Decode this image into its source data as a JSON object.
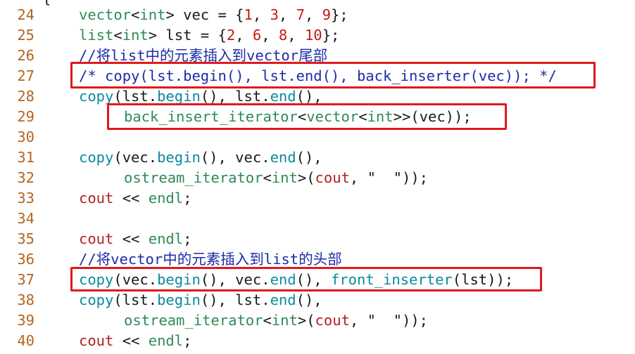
{
  "top_stub": "{",
  "lines": [
    {
      "num": "24",
      "tokens": [
        [
          "vector",
          "kw"
        ],
        [
          "<",
          ""
        ],
        [
          "int",
          "kw"
        ],
        [
          "> vec = {",
          ""
        ],
        [
          "1",
          "num"
        ],
        [
          ", ",
          ""
        ],
        [
          "3",
          "num"
        ],
        [
          ", ",
          ""
        ],
        [
          "7",
          "num"
        ],
        [
          ", ",
          ""
        ],
        [
          "9",
          "num"
        ],
        [
          "};",
          ""
        ]
      ]
    },
    {
      "num": "25",
      "tokens": [
        [
          "list",
          "kw"
        ],
        [
          "<",
          ""
        ],
        [
          "int",
          "kw"
        ],
        [
          "> lst = {",
          ""
        ],
        [
          "2",
          "num"
        ],
        [
          ", ",
          ""
        ],
        [
          "6",
          "num"
        ],
        [
          ", ",
          ""
        ],
        [
          "8",
          "num"
        ],
        [
          ", ",
          ""
        ],
        [
          "10",
          "num"
        ],
        [
          "};",
          ""
        ]
      ]
    },
    {
      "num": "26",
      "tokens": [
        [
          "//将list中的元素插入到vector尾部",
          "cm"
        ]
      ]
    },
    {
      "num": "27",
      "tokens": [
        [
          "/* copy(lst.begin(), lst.end(), back_inserter(vec)); */",
          "cm"
        ]
      ]
    },
    {
      "num": "28",
      "tokens": [
        [
          "copy",
          "fn"
        ],
        [
          "(lst.",
          ""
        ],
        [
          "begin",
          "fn"
        ],
        [
          "(), lst.",
          ""
        ],
        [
          "end",
          "fn"
        ],
        [
          "(),",
          ""
        ]
      ]
    },
    {
      "num": "29",
      "indent": 2,
      "tokens": [
        [
          "back_insert_iterator",
          "kw"
        ],
        [
          "<",
          ""
        ],
        [
          "vector",
          "kw"
        ],
        [
          "<",
          ""
        ],
        [
          "int",
          "kw"
        ],
        [
          ">>(vec));",
          ""
        ]
      ]
    },
    {
      "num": "30",
      "tokens": []
    },
    {
      "num": "31",
      "tokens": [
        [
          "copy",
          "fn"
        ],
        [
          "(vec.",
          ""
        ],
        [
          "begin",
          "fn"
        ],
        [
          "(), vec.",
          ""
        ],
        [
          "end",
          "fn"
        ],
        [
          "(),",
          ""
        ]
      ]
    },
    {
      "num": "32",
      "indent": 2,
      "tokens": [
        [
          "ostream_iterator",
          "kw"
        ],
        [
          "<",
          ""
        ],
        [
          "int",
          "kw"
        ],
        [
          ">(",
          ""
        ],
        [
          "cout",
          "str"
        ],
        [
          ", \"  \"));",
          ""
        ]
      ]
    },
    {
      "num": "33",
      "tokens": [
        [
          "cout",
          "str"
        ],
        [
          " << ",
          ""
        ],
        [
          "endl",
          "kw"
        ],
        [
          ";",
          ""
        ]
      ]
    },
    {
      "num": "34",
      "tokens": []
    },
    {
      "num": "35",
      "tokens": [
        [
          "cout",
          "str"
        ],
        [
          " << ",
          ""
        ],
        [
          "endl",
          "kw"
        ],
        [
          ";",
          ""
        ]
      ]
    },
    {
      "num": "36",
      "tokens": [
        [
          "//将vector中的元素插入到list的头部",
          "cm"
        ]
      ]
    },
    {
      "num": "37",
      "tokens": [
        [
          "copy",
          "fn"
        ],
        [
          "(vec.",
          ""
        ],
        [
          "begin",
          "fn"
        ],
        [
          "(), vec.",
          ""
        ],
        [
          "end",
          "fn"
        ],
        [
          "(), ",
          ""
        ],
        [
          "front_inserter",
          "fn"
        ],
        [
          "(lst));",
          ""
        ]
      ]
    },
    {
      "num": "38",
      "tokens": [
        [
          "copy",
          "fn"
        ],
        [
          "(lst.",
          ""
        ],
        [
          "begin",
          "fn"
        ],
        [
          "(), lst.",
          ""
        ],
        [
          "end",
          "fn"
        ],
        [
          "(),",
          ""
        ]
      ]
    },
    {
      "num": "39",
      "indent": 2,
      "tokens": [
        [
          "ostream_iterator",
          "kw"
        ],
        [
          "<",
          ""
        ],
        [
          "int",
          "kw"
        ],
        [
          ">(",
          ""
        ],
        [
          "cout",
          "str"
        ],
        [
          ", \"  \"));",
          ""
        ]
      ]
    },
    {
      "num": "40",
      "tokens": [
        [
          "cout",
          "str"
        ],
        [
          " << ",
          ""
        ],
        [
          "endl",
          "kw"
        ],
        [
          ";",
          ""
        ]
      ]
    }
  ]
}
